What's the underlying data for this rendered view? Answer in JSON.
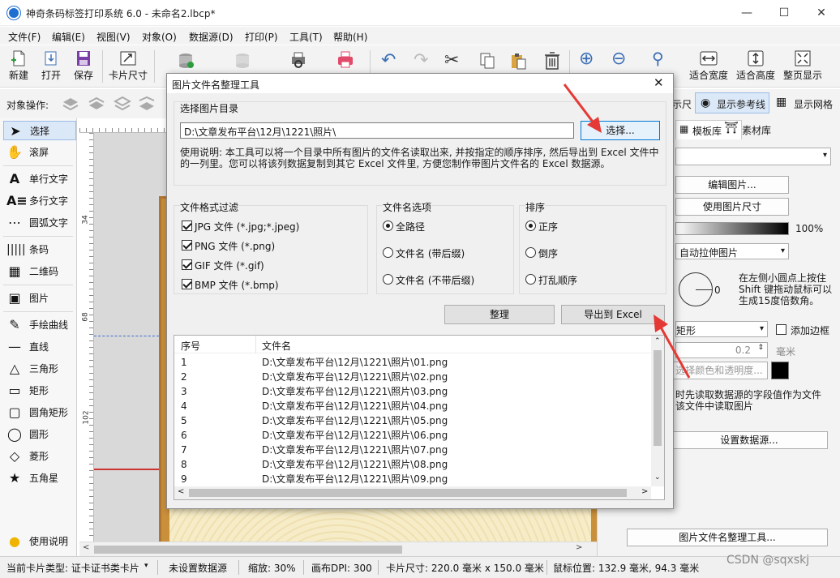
{
  "window": {
    "title": "神奇条码标签打印系统 6.0 - 未命名2.lbcp*"
  },
  "menu": [
    "文件(F)",
    "编辑(E)",
    "视图(V)",
    "对象(O)",
    "数据源(D)",
    "打印(P)",
    "工具(T)",
    "帮助(H)"
  ],
  "toolbar": {
    "new": "新建",
    "open": "打开",
    "save": "保存",
    "card_size": "卡片尺寸",
    "fit_width": "适合宽度",
    "fit_height": "适合高度",
    "full_page": "整页显示"
  },
  "object_ops": {
    "label": "对象操作:"
  },
  "tools": [
    "选择",
    "滚屏",
    "单行文字",
    "多行文字",
    "圆弧文字",
    "条码",
    "二维码",
    "图片",
    "手绘曲线",
    "直线",
    "三角形",
    "矩形",
    "圆角矩形",
    "圆形",
    "菱形",
    "五角星",
    "使用说明"
  ],
  "ruler": {
    "v1": "34",
    "v2": "68",
    "v3": "102"
  },
  "right_panel": {
    "ruler_partial": "示尺",
    "show_guides": "显示参考线",
    "show_grid": "显示网格",
    "tab_templates": "模板库",
    "tab_materials": "素材库",
    "edit_image": "编辑图片...",
    "use_image_size": "使用图片尺寸",
    "opacity": "100%",
    "stretch_mode": "自动拉伸图片",
    "angle": "0",
    "rotate_tip": "在左侧小圆点上按住Shift 键拖动鼠标可以生成15度倍数角。",
    "shape": "矩形",
    "add_border": "添加边框",
    "border_width": "0.2",
    "unit": "毫米",
    "color_button": "选择颜色和透明度...",
    "data_tip": "时先读取数据源的字段值作为文件该文件中读取图片",
    "set_datasource": "设置数据源...",
    "tool_button": "图片文件名整理工具..."
  },
  "status": {
    "card_type": "当前卡片类型: 证卡证书类卡片",
    "datasource": "未设置数据源",
    "zoom": "缩放: 30%",
    "dpi": "画布DPI: 300",
    "size": "卡片尺寸: 220.0 毫米 x 150.0 毫米",
    "pos": "鼠标位置: 132.9 毫米, 94.3 毫米"
  },
  "watermark": "CSDN @sqxskj",
  "dialog": {
    "title": "图片文件名整理工具",
    "dir_group": "选择图片目录",
    "dir_value": "D:\\文章发布平台\\12月\\1221\\照片\\",
    "choose_button": "选择...",
    "help": "使用说明: 本工具可以将一个目录中所有图片的文件名读取出来, 并按指定的顺序排序, 然后导出到 Excel 文件中的一列里。您可以将该列数据复制到其它 Excel 文件里, 方便您制作带图片文件名的 Excel 数据源。",
    "filter_group": "文件格式过滤",
    "filters": [
      "JPG 文件 (*.jpg;*.jpeg)",
      "PNG 文件 (*.png)",
      "GIF 文件 (*.gif)",
      "BMP 文件 (*.bmp)"
    ],
    "name_group": "文件名选项",
    "name_opts": [
      "全路径",
      "文件名 (带后缀)",
      "文件名 (不带后缀)"
    ],
    "sort_group": "排序",
    "sort_opts": [
      "正序",
      "倒序",
      "打乱顺序"
    ],
    "organize_button": "整理",
    "export_button": "导出到 Excel",
    "col_index": "序号",
    "col_name": "文件名",
    "rows": [
      [
        "1",
        "D:\\文章发布平台\\12月\\1221\\照片\\01.png"
      ],
      [
        "2",
        "D:\\文章发布平台\\12月\\1221\\照片\\02.png"
      ],
      [
        "3",
        "D:\\文章发布平台\\12月\\1221\\照片\\03.png"
      ],
      [
        "4",
        "D:\\文章发布平台\\12月\\1221\\照片\\04.png"
      ],
      [
        "5",
        "D:\\文章发布平台\\12月\\1221\\照片\\05.png"
      ],
      [
        "6",
        "D:\\文章发布平台\\12月\\1221\\照片\\06.png"
      ],
      [
        "7",
        "D:\\文章发布平台\\12月\\1221\\照片\\07.png"
      ],
      [
        "8",
        "D:\\文章发布平台\\12月\\1221\\照片\\08.png"
      ],
      [
        "9",
        "D:\\文章发布平台\\12月\\1221\\照片\\09.png"
      ]
    ]
  },
  "colors": {
    "accent": "#1f6fd1",
    "arrow": "#e53935"
  }
}
